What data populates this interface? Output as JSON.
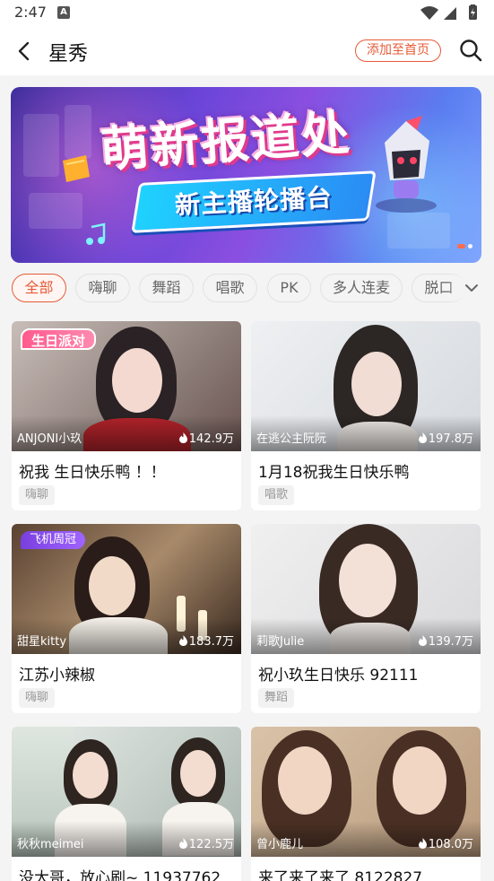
{
  "status_bar": {
    "time": "2:47",
    "sim_label": "A"
  },
  "navbar": {
    "title": "星秀",
    "add_home": "添加至首页"
  },
  "banner": {
    "headline": "萌新报道处",
    "subtitle": "新主播轮播台",
    "page_index": 1,
    "page_count": 2
  },
  "tabs": [
    "全部",
    "嗨聊",
    "舞蹈",
    "唱歌",
    "PK",
    "多人连麦",
    "脱口"
  ],
  "active_tab": "全部",
  "cards": [
    {
      "streamer": "ANJONI小玖",
      "heat": "142.9万",
      "title": "祝我 生日快乐鸭 ！！",
      "tag": "嗨聊",
      "badge": "生日派对"
    },
    {
      "streamer": "在逃公主阮阮",
      "heat": "197.8万",
      "title": "1月18祝我生日快乐鸭",
      "tag": "唱歌",
      "badge": ""
    },
    {
      "streamer": "甜星kitty",
      "heat": "183.7万",
      "title": "江苏小辣椒",
      "tag": "嗨聊",
      "badge": "飞机周冠"
    },
    {
      "streamer": "莉歌Julie",
      "heat": "139.7万",
      "title": "祝小玖生日快乐  92111",
      "tag": "舞蹈",
      "badge": ""
    },
    {
      "streamer": "秋秋meimei",
      "heat": "122.5万",
      "title": "没大哥，放心刷~ 11937762",
      "tag": "",
      "badge": ""
    },
    {
      "streamer": "曾小鹿儿",
      "heat": "108.0万",
      "title": "来了来了来了 8122827",
      "tag": "",
      "badge": ""
    }
  ],
  "colors": {
    "accent": "#e65b38",
    "background": "#f4f4f4"
  }
}
